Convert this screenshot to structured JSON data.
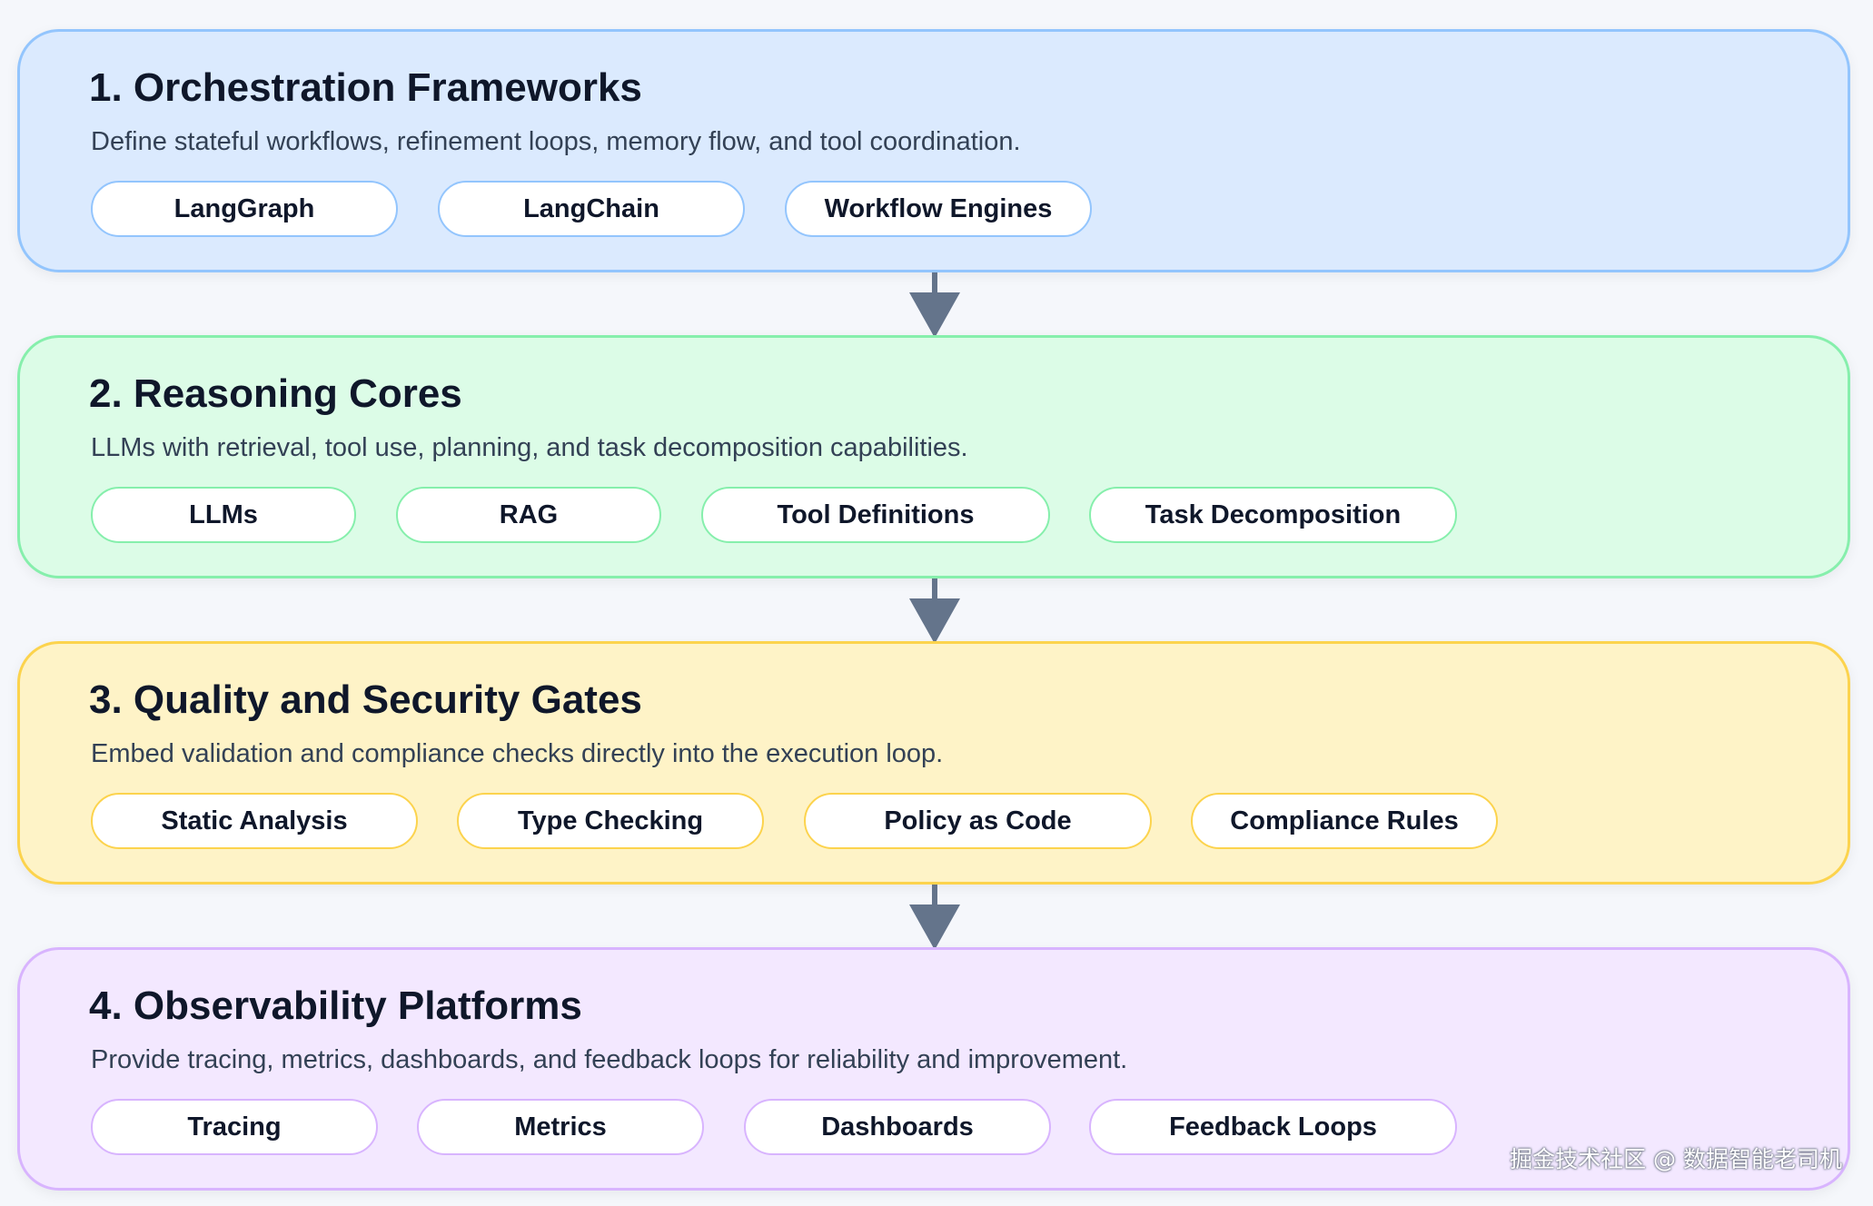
{
  "layers": [
    {
      "title": "1. Orchestration Frameworks",
      "description": "Define stateful workflows, refinement loops, memory flow, and tool coordination.",
      "chips": [
        "LangGraph",
        "LangChain",
        "Workflow Engines"
      ],
      "color": "#93c5fd"
    },
    {
      "title": "2. Reasoning Cores",
      "description": "LLMs with retrieval, tool use, planning, and task decomposition capabilities.",
      "chips": [
        "LLMs",
        "RAG",
        "Tool Definitions",
        "Task Decomposition"
      ],
      "color": "#86efac"
    },
    {
      "title": "3. Quality and Security Gates",
      "description": "Embed validation and compliance checks directly into the execution loop.",
      "chips": [
        "Static Analysis",
        "Type Checking",
        "Policy as Code",
        "Compliance Rules"
      ],
      "color": "#fcd34d"
    },
    {
      "title": "4. Observability Platforms",
      "description": "Provide tracing, metrics, dashboards, and feedback loops for reliability and improvement.",
      "chips": [
        "Tracing",
        "Metrics",
        "Dashboards",
        "Feedback Loops"
      ],
      "color": "#d8b4fe"
    }
  ],
  "arrow_color": "#64748b",
  "watermark": "掘金技术社区 @ 数据智能老司机"
}
